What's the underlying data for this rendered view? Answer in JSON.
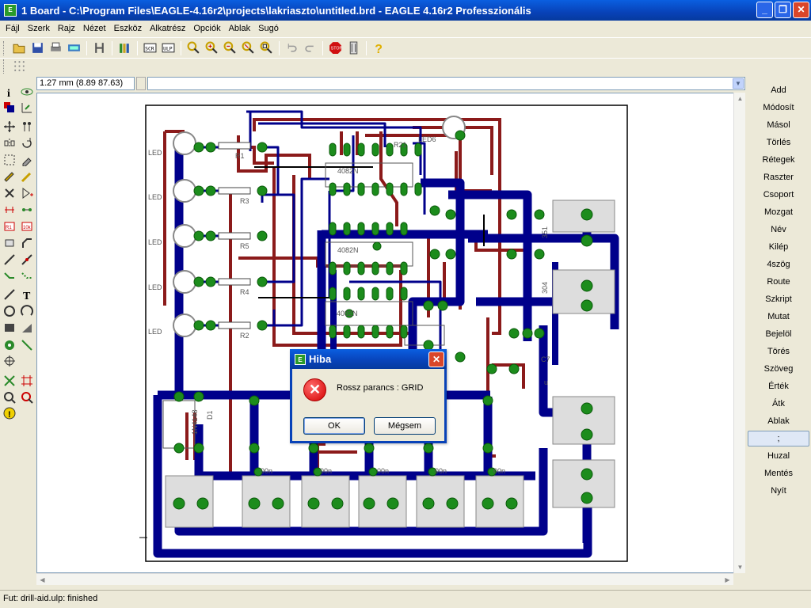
{
  "window": {
    "title": "1 Board - C:\\Program Files\\EAGLE-4.16r2\\projects\\lakriaszto\\untitled.brd - EAGLE 4.16r2 Professzionális",
    "minimize": "_",
    "maximize": "❐",
    "close": "✕"
  },
  "menu": [
    "Fájl",
    "Szerk",
    "Rajz",
    "Nézet",
    "Eszköz",
    "Alkatrész",
    "Opciók",
    "Ablak",
    "Sugó"
  ],
  "coordinates": "1.27 mm (8.89 87.63)",
  "command_input": {
    "value": ""
  },
  "right_commands": [
    "Add",
    "Módosít",
    "Másol",
    "Törlés",
    "Rétegek",
    "Raszter",
    "Csoport",
    "Mozgat",
    "Név",
    "Kilép",
    "4szög",
    "Route",
    "Szkript",
    "Mutat",
    "Bejelöl",
    "Törés",
    "Szöveg",
    "Érték",
    "Átk",
    "Ablak",
    ";",
    "Huzal",
    "Mentés",
    "Nyít"
  ],
  "active_command": ";",
  "status": "Fut: drill-aid.ulp: finished",
  "dialog": {
    "title": "Hiba",
    "message": "Rossz parancs :  GRID",
    "ok": "OK",
    "cancel": "Mégsem",
    "icon": "error-icon",
    "close": "✕"
  },
  "board_labels": {
    "leds": [
      "LED",
      "LED",
      "LED",
      "LED",
      "LED"
    ],
    "led6": "LED6",
    "resistors": [
      "R1",
      "R3",
      "R5",
      "R4",
      "R2",
      "R21"
    ],
    "chips": [
      "4082N",
      "4082N",
      "4082N"
    ],
    "diodes": [
      "1N4148",
      "D1"
    ],
    "caps": [
      "00n",
      "00n",
      "00n",
      "00n",
      "00n"
    ],
    "misc": [
      "351",
      "304",
      "C7",
      "u"
    ]
  },
  "colors": {
    "top_copper": "#8b1a1a",
    "bottom_copper": "#00008b",
    "pad": "#1c8c1c",
    "outline": "#000000"
  }
}
